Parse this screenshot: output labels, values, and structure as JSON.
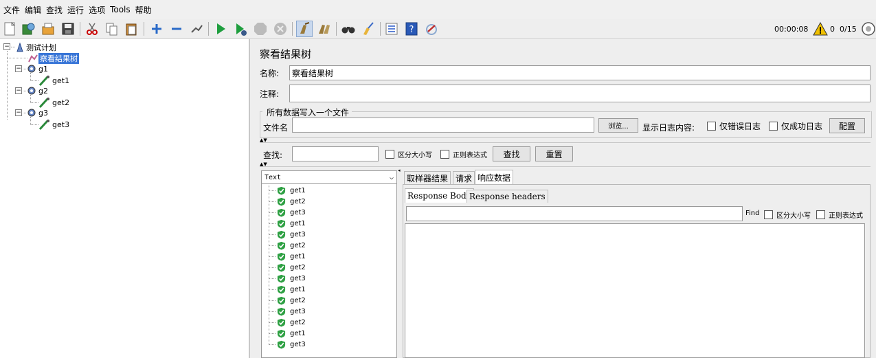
{
  "menu": [
    "文件",
    "编辑",
    "查找",
    "运行",
    "选项",
    "Tools",
    "帮助"
  ],
  "toolbar": {
    "icons": [
      "new-icon",
      "templates-icon",
      "open-icon",
      "save-icon",
      "cut-icon",
      "copy-icon",
      "paste-icon",
      "expand-icon",
      "collapse-icon",
      "toggle-icon",
      "start-icon",
      "start-no-pause-icon",
      "stop-icon",
      "shutdown-icon",
      "clear-icon",
      "clear-all-icon",
      "search-icon",
      "reset-search-icon",
      "function-helper-icon",
      "help-icon",
      "remote-icon"
    ],
    "timer": "00:00:08",
    "warning_count": "0",
    "threads": "0/15"
  },
  "tree": {
    "root": "测试计划",
    "selected": "察看结果树",
    "groups": [
      {
        "name": "g1",
        "sampler": "get1"
      },
      {
        "name": "g2",
        "sampler": "get2"
      },
      {
        "name": "g3",
        "sampler": "get3"
      }
    ]
  },
  "panel": {
    "title": "察看结果树",
    "name_label": "名称:",
    "name_value": "察看结果树",
    "comment_label": "注释:",
    "comment_value": "",
    "file_group_title": "所有数据写入一个文件",
    "filename_label": "文件名",
    "filename_value": "",
    "browse_label": "浏览...",
    "log_display_label": "显示日志内容:",
    "errors_only_label": "仅错误日志",
    "success_only_label": "仅成功日志",
    "configure_label": "配置",
    "search_label": "查找:",
    "search_value": "",
    "case_sensitive_label": "区分大小写",
    "regex_label": "正则表达式",
    "search_button": "查找",
    "reset_button": "重置"
  },
  "results": {
    "renderer": "Text",
    "items": [
      "get1",
      "get2",
      "get3",
      "get1",
      "get3",
      "get2",
      "get1",
      "get2",
      "get3",
      "get1",
      "get2",
      "get3",
      "get2",
      "get1",
      "get3"
    ]
  },
  "detail": {
    "tabs": [
      "取样器结果",
      "请求",
      "响应数据"
    ],
    "active_tab": "响应数据",
    "subtabs": [
      "Response Body",
      "Response headers"
    ],
    "find_label": "Find",
    "find_value": "",
    "case_sensitive_label": "区分大小写",
    "regex_label": "正则表达式"
  }
}
